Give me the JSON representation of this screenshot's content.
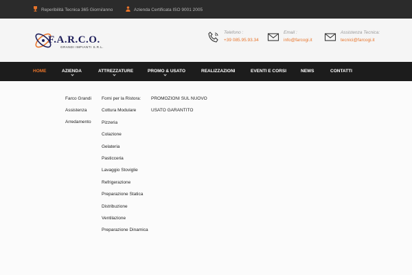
{
  "topbar": {
    "items": [
      {
        "icon": "trophy-icon",
        "text": "Reperibilità Tecnica 365 Giorni/anno"
      },
      {
        "icon": "user-icon",
        "text": "Azienda Certificata ISO 9001 2005"
      }
    ]
  },
  "logo": {
    "name": "F.A.R.C.O.",
    "subtitle": "GRANDI IMPIANTI S.R.L."
  },
  "contacts": [
    {
      "icon": "phone-icon",
      "label": "Telefono :",
      "value": "+39 085.95.93.34"
    },
    {
      "icon": "envelope-icon",
      "label": "Email :",
      "value": "info@farcogi.it"
    },
    {
      "icon": "envelope-icon",
      "label": "Assistenza Tecnica:",
      "value": "tecnici@farcogi.it"
    }
  ],
  "nav": {
    "items": [
      {
        "label": "HOME",
        "active": true
      },
      {
        "label": "AZIENDA",
        "dropdown": true
      },
      {
        "label": "ATTREZZATURE",
        "dropdown": true
      },
      {
        "label": "PROMO & USATO",
        "dropdown": true
      },
      {
        "label": "REALIZZAZIONI"
      },
      {
        "label": "EVENTI E CORSI"
      },
      {
        "label": "NEWS"
      },
      {
        "label": "CONTATTI"
      }
    ]
  },
  "menu": {
    "azienda": [
      "Farco Grandi",
      "Assistenza",
      "Arredamento"
    ],
    "attrezzature": [
      "Forni per la Ristora:",
      "Cottura Modulare",
      "Pizzeria",
      "Colazione",
      "Gelateria",
      "Pasticceria",
      "Lavaggio Stoviglie",
      "Refrigerazione",
      "Preparazione Statica",
      "Distribuzione",
      "Ventilazione",
      "Preparazione Dinamica"
    ],
    "promo": [
      "PROMOZIONI SUL NUOVO",
      "USATO GARANTITO"
    ]
  },
  "colors": {
    "accent": "#e8742a",
    "dark": "#1c1c1c",
    "topbar": "#2b2b2b",
    "logo": "#1e1e5a"
  }
}
